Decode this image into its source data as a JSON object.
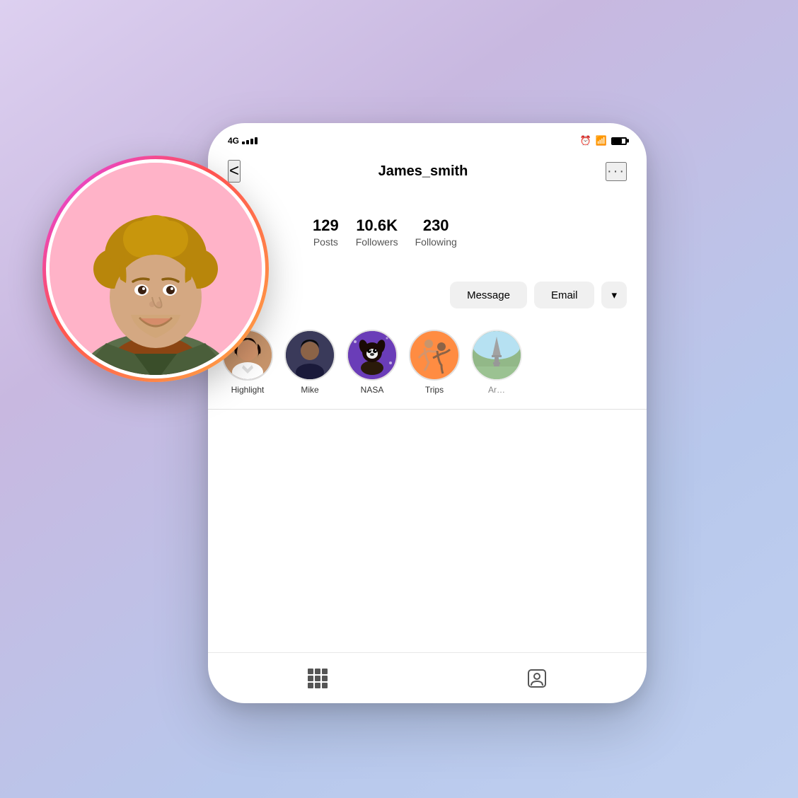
{
  "background": {
    "gradient_start": "#ddd0f0",
    "gradient_end": "#c0d0f0"
  },
  "phone": {
    "status_bar": {
      "signal_type": "4G",
      "time": "",
      "icons": [
        "clock",
        "wifi",
        "battery"
      ]
    },
    "header": {
      "back_label": "<",
      "username": "James_smith",
      "more_label": "···"
    },
    "stats": [
      {
        "number": "129",
        "label": "Posts"
      },
      {
        "number": "10.6K",
        "label": "Followers"
      },
      {
        "number": "230",
        "label": "Following"
      }
    ],
    "buttons": {
      "message_label": "Message",
      "email_label": "Email",
      "dropdown_label": "▾"
    },
    "highlights": [
      {
        "name": "Highlight",
        "type": "person_female"
      },
      {
        "name": "Mike",
        "type": "person_male"
      },
      {
        "name": "NASA",
        "type": "dog"
      },
      {
        "name": "Trips",
        "type": "dancing"
      },
      {
        "name": "Ar…",
        "type": "city"
      }
    ],
    "tabs": [
      {
        "icon": "grid",
        "label": "Grid"
      },
      {
        "icon": "person-tag",
        "label": "Tagged"
      }
    ]
  },
  "avatar": {
    "ring_gradient": "pink-to-yellow",
    "background": "pink"
  }
}
